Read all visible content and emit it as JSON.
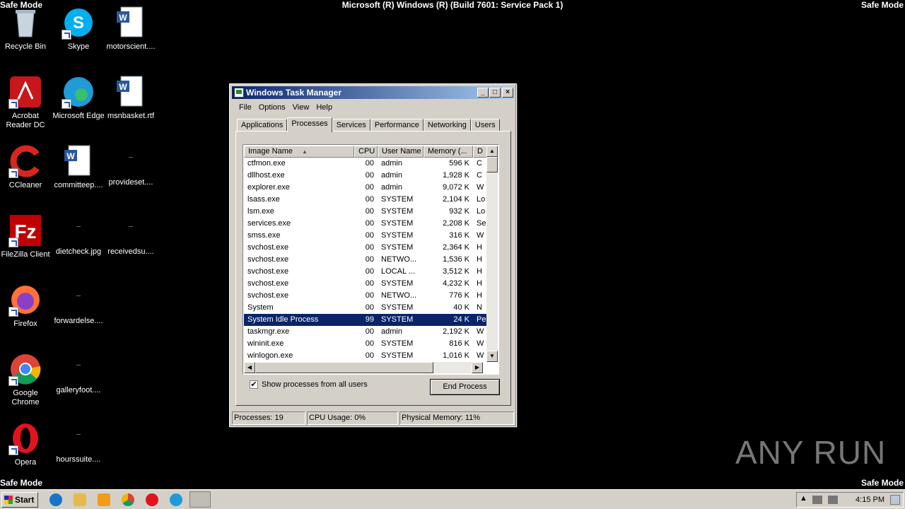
{
  "screen": {
    "safe_mode_label": "Safe Mode",
    "build_text": "Microsoft (R) Windows (R) (Build 7601: Service Pack 1)"
  },
  "desktop_icons": [
    {
      "label": "Recycle Bin",
      "icon": "recycle-bin-icon"
    },
    {
      "label": "Skype",
      "icon": "skype-icon"
    },
    {
      "label": "motorscient....",
      "icon": "word-doc-icon"
    },
    {
      "label": "Acrobat Reader DC",
      "icon": "acrobat-icon"
    },
    {
      "label": "Microsoft Edge",
      "icon": "edge-icon"
    },
    {
      "label": "msnbasket.rtf",
      "icon": "word-doc-icon"
    },
    {
      "label": "CCleaner",
      "icon": "ccleaner-icon"
    },
    {
      "label": "committeep....",
      "icon": "word-doc-icon"
    },
    {
      "label": "provideset....",
      "icon": "file-icon"
    },
    {
      "label": "FileZilla Client",
      "icon": "filezilla-icon"
    },
    {
      "label": "dietcheck.jpg",
      "icon": "file-icon"
    },
    {
      "label": "receivedsu....",
      "icon": "file-icon"
    },
    {
      "label": "Firefox",
      "icon": "firefox-icon"
    },
    {
      "label": "forwardelse....",
      "icon": "file-icon"
    },
    {
      "label": "Google Chrome",
      "icon": "chrome-icon"
    },
    {
      "label": "galleryfoot....",
      "icon": "file-icon"
    },
    {
      "label": "Opera",
      "icon": "opera-icon"
    },
    {
      "label": "hourssuite....",
      "icon": "file-icon"
    }
  ],
  "window": {
    "title": "Windows Task Manager",
    "menu": [
      "File",
      "Options",
      "View",
      "Help"
    ],
    "tabs": [
      "Applications",
      "Processes",
      "Services",
      "Performance",
      "Networking",
      "Users"
    ],
    "active_tab": "Processes",
    "columns": [
      "Image Name",
      "CPU",
      "User Name",
      "Memory (...",
      "D"
    ],
    "processes": [
      {
        "name": "ctfmon.exe",
        "cpu": "00",
        "user": "admin",
        "mem": "596 K",
        "d": "C"
      },
      {
        "name": "dllhost.exe",
        "cpu": "00",
        "user": "admin",
        "mem": "1,928 K",
        "d": "C"
      },
      {
        "name": "explorer.exe",
        "cpu": "00",
        "user": "admin",
        "mem": "9,072 K",
        "d": "W"
      },
      {
        "name": "lsass.exe",
        "cpu": "00",
        "user": "SYSTEM",
        "mem": "2,104 K",
        "d": "Lo"
      },
      {
        "name": "lsm.exe",
        "cpu": "00",
        "user": "SYSTEM",
        "mem": "932 K",
        "d": "Lo"
      },
      {
        "name": "services.exe",
        "cpu": "00",
        "user": "SYSTEM",
        "mem": "2,208 K",
        "d": "Se"
      },
      {
        "name": "smss.exe",
        "cpu": "00",
        "user": "SYSTEM",
        "mem": "316 K",
        "d": "W"
      },
      {
        "name": "svchost.exe",
        "cpu": "00",
        "user": "SYSTEM",
        "mem": "2,364 K",
        "d": "H"
      },
      {
        "name": "svchost.exe",
        "cpu": "00",
        "user": "NETWO...",
        "mem": "1,536 K",
        "d": "H"
      },
      {
        "name": "svchost.exe",
        "cpu": "00",
        "user": "LOCAL ...",
        "mem": "3,512 K",
        "d": "H"
      },
      {
        "name": "svchost.exe",
        "cpu": "00",
        "user": "SYSTEM",
        "mem": "4,232 K",
        "d": "H"
      },
      {
        "name": "svchost.exe",
        "cpu": "00",
        "user": "NETWO...",
        "mem": "776 K",
        "d": "H"
      },
      {
        "name": "System",
        "cpu": "00",
        "user": "SYSTEM",
        "mem": "40 K",
        "d": "N"
      },
      {
        "name": "System Idle Process",
        "cpu": "99",
        "user": "SYSTEM",
        "mem": "24 K",
        "d": "Pe"
      },
      {
        "name": "taskmgr.exe",
        "cpu": "00",
        "user": "admin",
        "mem": "2,192 K",
        "d": "W"
      },
      {
        "name": "wininit.exe",
        "cpu": "00",
        "user": "SYSTEM",
        "mem": "816 K",
        "d": "W"
      },
      {
        "name": "winlogon.exe",
        "cpu": "00",
        "user": "SYSTEM",
        "mem": "1,016 K",
        "d": "W"
      }
    ],
    "selected_process": "System Idle Process",
    "show_all_label": "Show processes from all users",
    "show_all_checked": true,
    "end_process_label": "End Process",
    "status": {
      "processes": "Processes: 19",
      "cpu": "CPU Usage: 0%",
      "memory": "Physical Memory: 11%"
    }
  },
  "taskbar": {
    "start_label": "Start",
    "clock": "4:15 PM"
  },
  "watermark": "ANY RUN",
  "colors": {
    "desktop": "#000000",
    "selection": "#0a246a",
    "chrome": "#d4d0c8"
  }
}
